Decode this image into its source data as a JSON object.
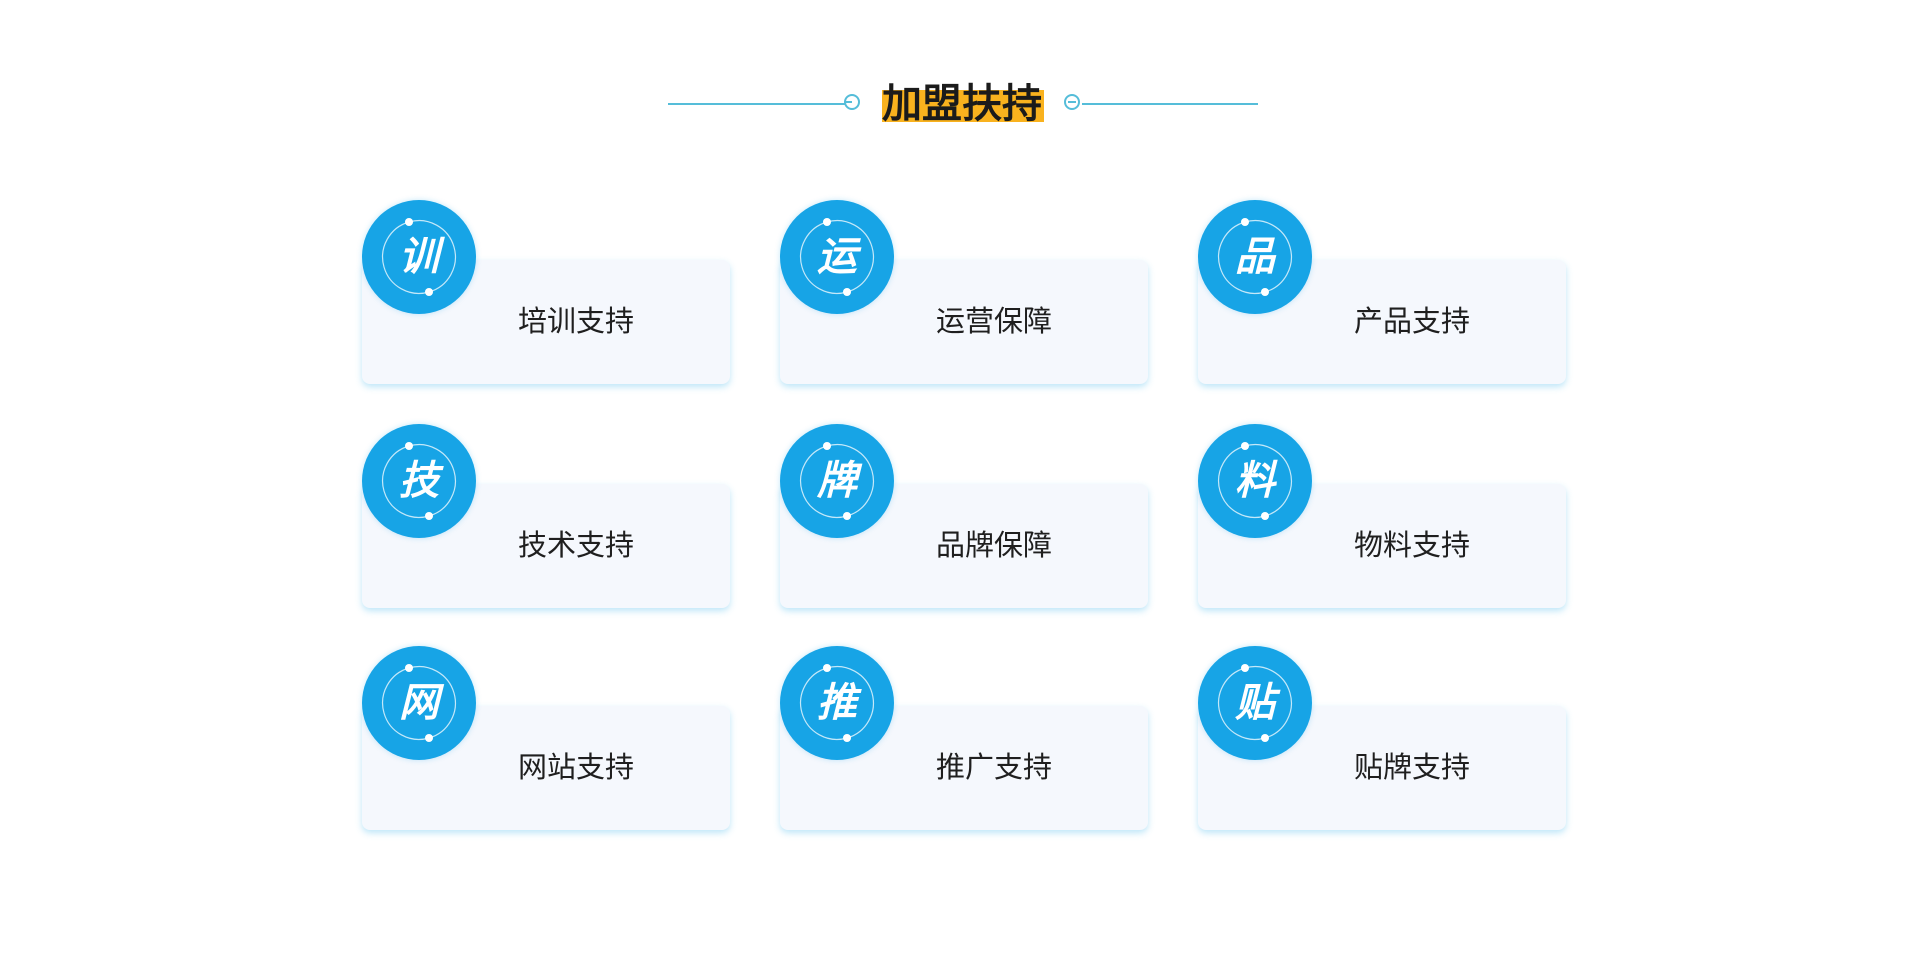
{
  "section": {
    "title": "加盟扶持"
  },
  "colors": {
    "accent_blue": "#17a4e6",
    "line_blue": "#55bdd9",
    "highlight_orange": "#f9b21e",
    "card_bg": "#f5f8fd"
  },
  "cards": [
    {
      "badge_char": "训",
      "label": "培训支持"
    },
    {
      "badge_char": "运",
      "label": "运营保障"
    },
    {
      "badge_char": "品",
      "label": "产品支持"
    },
    {
      "badge_char": "技",
      "label": "技术支持"
    },
    {
      "badge_char": "牌",
      "label": "品牌保障"
    },
    {
      "badge_char": "料",
      "label": "物料支持"
    },
    {
      "badge_char": "网",
      "label": "网站支持"
    },
    {
      "badge_char": "推",
      "label": "推广支持"
    },
    {
      "badge_char": "贴",
      "label": "贴牌支持"
    }
  ]
}
